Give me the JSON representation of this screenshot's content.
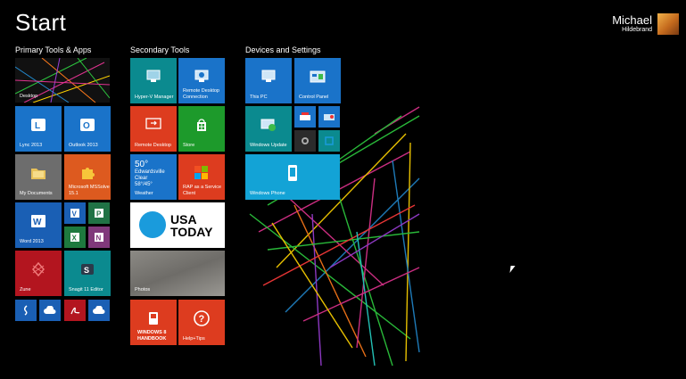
{
  "screen": {
    "title": "Start",
    "user_first_name": "Michael",
    "user_last_name": "Hildebrand"
  },
  "groups": [
    "Primary Tools & Apps",
    "Secondary Tools",
    "Devices and Settings"
  ],
  "tiles": {
    "desktop": "Desktop",
    "lync": "Lync 2013",
    "outlook": "Outlook 2013",
    "my_documents": "My Documents",
    "mssolve": "Microsoft MSSolve 15.1",
    "word": "Word 2013",
    "zune": "Zune",
    "snagit": "Snagit 11 Editor",
    "hyperv": "Hyper-V Manager",
    "rdc": "Remote Desktop Connection",
    "remote_desktop": "Remote Desktop",
    "store": "Store",
    "weather": "Weather",
    "weather_temp": "50°",
    "weather_city": "Edwardsville",
    "weather_cond": "Clear",
    "weather_range": "58°/45°",
    "rap": "RAP as a Service Client",
    "usa_today_1": "USA",
    "usa_today_2": "TODAY",
    "photos": "Photos",
    "handbook": "WINDOWS 8 HANDBOOK",
    "help": "Help+Tips",
    "this_pc": "This PC",
    "control_panel": "Control Panel",
    "windows_update": "Windows Update",
    "windows_phone": "Windows Phone"
  },
  "colors": {
    "blue": "#1a73c9",
    "teal": "#0b8a8f",
    "red": "#c8321d",
    "green": "#1d9a2b",
    "orange": "#dd5a1f",
    "darkred": "#b3151f",
    "cyan": "#13a3d6",
    "gray": "#6d6d6d"
  }
}
